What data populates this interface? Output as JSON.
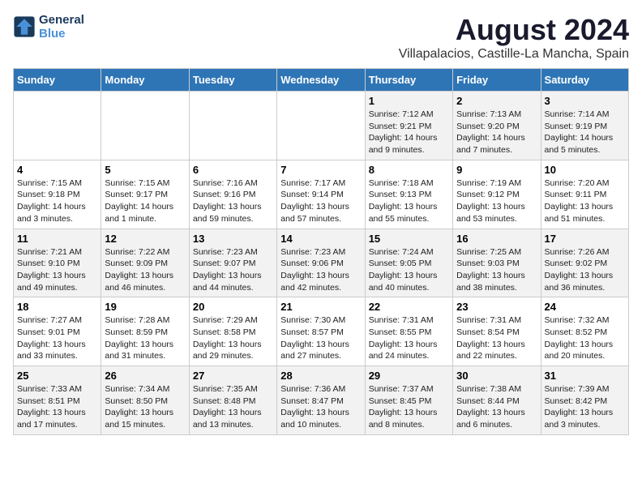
{
  "logo": {
    "text_general": "General",
    "text_blue": "Blue"
  },
  "title": "August 2024",
  "subtitle": "Villapalacios, Castille-La Mancha, Spain",
  "days_of_week": [
    "Sunday",
    "Monday",
    "Tuesday",
    "Wednesday",
    "Thursday",
    "Friday",
    "Saturday"
  ],
  "weeks": [
    [
      {
        "day": "",
        "info": ""
      },
      {
        "day": "",
        "info": ""
      },
      {
        "day": "",
        "info": ""
      },
      {
        "day": "",
        "info": ""
      },
      {
        "day": "1",
        "info": "Sunrise: 7:12 AM\nSunset: 9:21 PM\nDaylight: 14 hours\nand 9 minutes."
      },
      {
        "day": "2",
        "info": "Sunrise: 7:13 AM\nSunset: 9:20 PM\nDaylight: 14 hours\nand 7 minutes."
      },
      {
        "day": "3",
        "info": "Sunrise: 7:14 AM\nSunset: 9:19 PM\nDaylight: 14 hours\nand 5 minutes."
      }
    ],
    [
      {
        "day": "4",
        "info": "Sunrise: 7:15 AM\nSunset: 9:18 PM\nDaylight: 14 hours\nand 3 minutes."
      },
      {
        "day": "5",
        "info": "Sunrise: 7:15 AM\nSunset: 9:17 PM\nDaylight: 14 hours\nand 1 minute."
      },
      {
        "day": "6",
        "info": "Sunrise: 7:16 AM\nSunset: 9:16 PM\nDaylight: 13 hours\nand 59 minutes."
      },
      {
        "day": "7",
        "info": "Sunrise: 7:17 AM\nSunset: 9:14 PM\nDaylight: 13 hours\nand 57 minutes."
      },
      {
        "day": "8",
        "info": "Sunrise: 7:18 AM\nSunset: 9:13 PM\nDaylight: 13 hours\nand 55 minutes."
      },
      {
        "day": "9",
        "info": "Sunrise: 7:19 AM\nSunset: 9:12 PM\nDaylight: 13 hours\nand 53 minutes."
      },
      {
        "day": "10",
        "info": "Sunrise: 7:20 AM\nSunset: 9:11 PM\nDaylight: 13 hours\nand 51 minutes."
      }
    ],
    [
      {
        "day": "11",
        "info": "Sunrise: 7:21 AM\nSunset: 9:10 PM\nDaylight: 13 hours\nand 49 minutes."
      },
      {
        "day": "12",
        "info": "Sunrise: 7:22 AM\nSunset: 9:09 PM\nDaylight: 13 hours\nand 46 minutes."
      },
      {
        "day": "13",
        "info": "Sunrise: 7:23 AM\nSunset: 9:07 PM\nDaylight: 13 hours\nand 44 minutes."
      },
      {
        "day": "14",
        "info": "Sunrise: 7:23 AM\nSunset: 9:06 PM\nDaylight: 13 hours\nand 42 minutes."
      },
      {
        "day": "15",
        "info": "Sunrise: 7:24 AM\nSunset: 9:05 PM\nDaylight: 13 hours\nand 40 minutes."
      },
      {
        "day": "16",
        "info": "Sunrise: 7:25 AM\nSunset: 9:03 PM\nDaylight: 13 hours\nand 38 minutes."
      },
      {
        "day": "17",
        "info": "Sunrise: 7:26 AM\nSunset: 9:02 PM\nDaylight: 13 hours\nand 36 minutes."
      }
    ],
    [
      {
        "day": "18",
        "info": "Sunrise: 7:27 AM\nSunset: 9:01 PM\nDaylight: 13 hours\nand 33 minutes."
      },
      {
        "day": "19",
        "info": "Sunrise: 7:28 AM\nSunset: 8:59 PM\nDaylight: 13 hours\nand 31 minutes."
      },
      {
        "day": "20",
        "info": "Sunrise: 7:29 AM\nSunset: 8:58 PM\nDaylight: 13 hours\nand 29 minutes."
      },
      {
        "day": "21",
        "info": "Sunrise: 7:30 AM\nSunset: 8:57 PM\nDaylight: 13 hours\nand 27 minutes."
      },
      {
        "day": "22",
        "info": "Sunrise: 7:31 AM\nSunset: 8:55 PM\nDaylight: 13 hours\nand 24 minutes."
      },
      {
        "day": "23",
        "info": "Sunrise: 7:31 AM\nSunset: 8:54 PM\nDaylight: 13 hours\nand 22 minutes."
      },
      {
        "day": "24",
        "info": "Sunrise: 7:32 AM\nSunset: 8:52 PM\nDaylight: 13 hours\nand 20 minutes."
      }
    ],
    [
      {
        "day": "25",
        "info": "Sunrise: 7:33 AM\nSunset: 8:51 PM\nDaylight: 13 hours\nand 17 minutes."
      },
      {
        "day": "26",
        "info": "Sunrise: 7:34 AM\nSunset: 8:50 PM\nDaylight: 13 hours\nand 15 minutes."
      },
      {
        "day": "27",
        "info": "Sunrise: 7:35 AM\nSunset: 8:48 PM\nDaylight: 13 hours\nand 13 minutes."
      },
      {
        "day": "28",
        "info": "Sunrise: 7:36 AM\nSunset: 8:47 PM\nDaylight: 13 hours\nand 10 minutes."
      },
      {
        "day": "29",
        "info": "Sunrise: 7:37 AM\nSunset: 8:45 PM\nDaylight: 13 hours\nand 8 minutes."
      },
      {
        "day": "30",
        "info": "Sunrise: 7:38 AM\nSunset: 8:44 PM\nDaylight: 13 hours\nand 6 minutes."
      },
      {
        "day": "31",
        "info": "Sunrise: 7:39 AM\nSunset: 8:42 PM\nDaylight: 13 hours\nand 3 minutes."
      }
    ]
  ]
}
